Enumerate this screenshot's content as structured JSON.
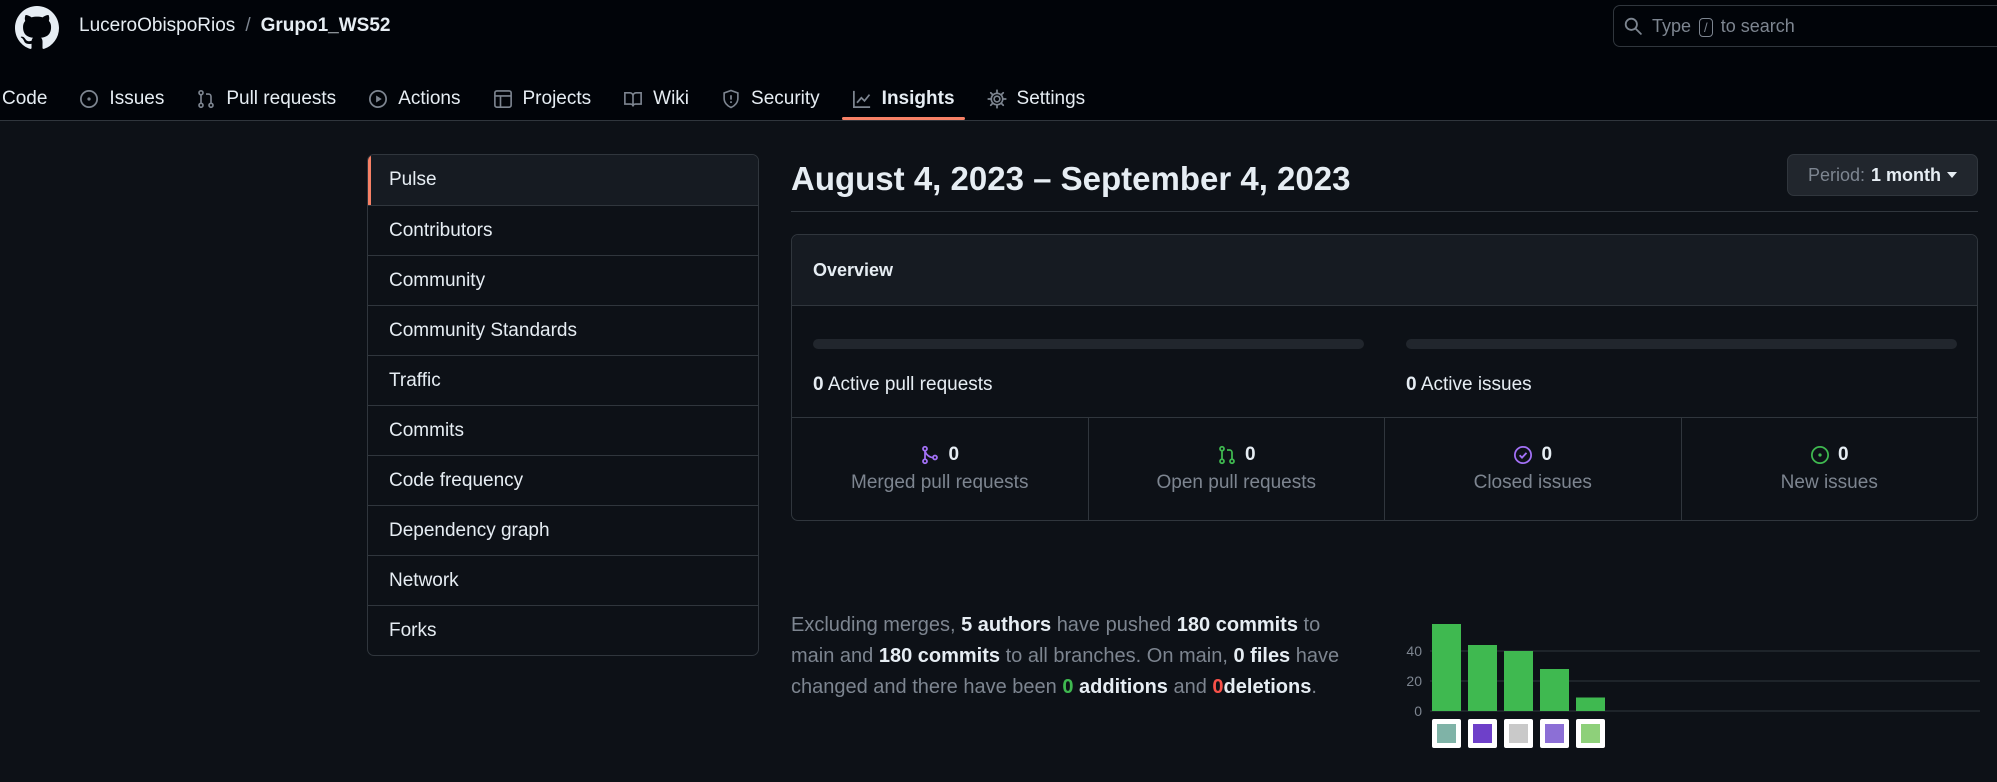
{
  "header": {
    "owner": "LuceroObispoRios",
    "separator": "/",
    "repo": "Grupo1_WS52",
    "search_before": "Type",
    "search_key": "/",
    "search_after": "to search"
  },
  "tabs": [
    {
      "label": "Code",
      "icon": "code-icon"
    },
    {
      "label": "Issues",
      "icon": "issue-opened-icon"
    },
    {
      "label": "Pull requests",
      "icon": "git-pull-request-icon"
    },
    {
      "label": "Actions",
      "icon": "play-icon"
    },
    {
      "label": "Projects",
      "icon": "table-icon"
    },
    {
      "label": "Wiki",
      "icon": "book-icon"
    },
    {
      "label": "Security",
      "icon": "shield-icon"
    },
    {
      "label": "Insights",
      "icon": "graph-icon",
      "active": true
    },
    {
      "label": "Settings",
      "icon": "gear-icon"
    }
  ],
  "sidebar": {
    "items": [
      "Pulse",
      "Contributors",
      "Community",
      "Community Standards",
      "Traffic",
      "Commits",
      "Code frequency",
      "Dependency graph",
      "Network",
      "Forks"
    ],
    "active": "Pulse"
  },
  "main": {
    "date_range": "August 4, 2023 – September 4, 2023",
    "period_label": "Period:",
    "period_value": "1 month",
    "overview_title": "Overview",
    "active_prs_count": "0",
    "active_prs_label": "Active pull requests",
    "active_issues_count": "0",
    "active_issues_label": "Active issues",
    "stats": [
      {
        "value": "0",
        "label": "Merged pull requests",
        "icon": "git-merge-icon",
        "color": "#a371f7"
      },
      {
        "value": "0",
        "label": "Open pull requests",
        "icon": "git-pull-request-icon",
        "color": "#3fb950"
      },
      {
        "value": "0",
        "label": "Closed issues",
        "icon": "issue-closed-icon",
        "color": "#a371f7"
      },
      {
        "value": "0",
        "label": "New issues",
        "icon": "issue-opened-icon",
        "color": "#3fb950"
      }
    ],
    "summary": {
      "t1": "Excluding merges,",
      "authors": "5 authors",
      "t2": "have pushed",
      "commits_main": "180 commits",
      "t3": "to main and",
      "commits_all": "180 commits",
      "t4": "to all branches. On main,",
      "files": "0 files",
      "t5": "have changed and there have been",
      "additions_num": "0",
      "additions_word": "additions",
      "t6": "and",
      "deletions_num": "0",
      "deletions_word": "deletions",
      "t7": "."
    }
  },
  "chart_data": {
    "type": "bar",
    "categories": [
      "author-1",
      "author-2",
      "author-3",
      "author-4",
      "author-5"
    ],
    "values": [
      58,
      44,
      40,
      28,
      9
    ],
    "yticks": [
      0,
      20,
      40
    ],
    "ylim": [
      0,
      60
    ],
    "bar_color": "#3fb950",
    "grid": true,
    "avatar_colors": [
      "#7fb3a7",
      "#6e40c9",
      "#c9c9c9",
      "#8c6fd6",
      "#8ed07a"
    ]
  }
}
